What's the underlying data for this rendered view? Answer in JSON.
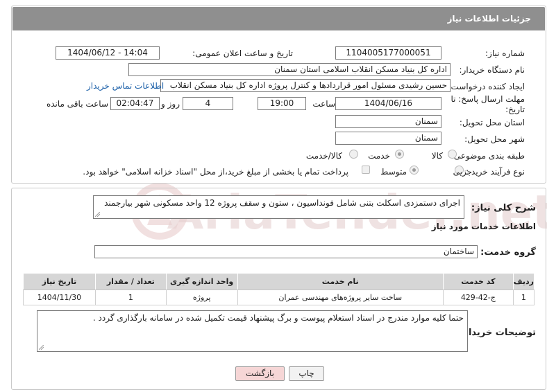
{
  "header": {
    "title": "جزئیات اطلاعات نیاز"
  },
  "fields": {
    "need_number_label": "شماره نیاز:",
    "need_number": "1104005177000051",
    "announce_label": "تاریخ و ساعت اعلان عمومی:",
    "announce_value": "1404/06/12 - 14:04",
    "buyer_org_label": "نام دستگاه خریدار:",
    "buyer_org": "اداره کل بنیاد مسکن انقلاب اسلامی استان سمنان",
    "creator_label": "ایجاد کننده درخواست:",
    "creator": "حسین رشیدی مسئول امور قراردادها و کنترل پروژه اداره کل بنیاد مسکن انقلاب",
    "buyer_contact_link": "اطلاعات تماس خریدار",
    "deadline_label_1": "مهلت ارسال پاسخ: تا",
    "deadline_label_2": "تاریخ:",
    "deadline_date": "1404/06/16",
    "time_label": "ساعت",
    "deadline_time": "19:00",
    "days_value": "4",
    "days_label": "روز و",
    "remaining_time": "02:04:47",
    "remaining_label": "ساعت باقی مانده",
    "province_label": "استان محل تحویل:",
    "province": "سمنان",
    "city_label": "شهر محل تحویل:",
    "city": "سمنان",
    "category_label": "طبقه بندی موضوعی:",
    "category_options": [
      "کالا",
      "خدمت",
      "کالا/خدمت"
    ],
    "process_label": "نوع فرآیند خرید :",
    "process_options": [
      "جزیی",
      "متوسط"
    ],
    "payment_note": "پرداخت تمام یا بخشی از مبلغ خرید،از محل \"اسناد خزانه اسلامی\" خواهد بود."
  },
  "summary": {
    "label": "شرح کلی نیاز:",
    "text": "اجرای دستمزدی اسکلت بتنی شامل فونداسیون ، ستون و سقف پروژه 12 واحد مسکونی شهر بیارجمند"
  },
  "services": {
    "title": "اطلاعات خدمات مورد نیاز",
    "group_label": "گروه خدمت:",
    "group_value": "ساختمان",
    "columns": [
      "ردیف",
      "کد خدمت",
      "نام خدمت",
      "واحد اندازه گیری",
      "تعداد / مقدار",
      "تاریخ نیاز"
    ],
    "rows": [
      {
        "row": "1",
        "code": "ج-42-429",
        "name": "ساخت سایر پروژه‌های مهندسی عمران",
        "unit": "پروژه",
        "qty": "1",
        "date": "1404/11/30"
      }
    ]
  },
  "buyer_notes": {
    "label": "توضیحات خریدار:",
    "text": "حتما کلیه موارد مندرج در اسناد استعلام پیوست و برگ پیشنهاد قیمت تکمیل شده در سامانه بارگذاری گردد ."
  },
  "buttons": {
    "print": "چاپ",
    "back": "بازگشت"
  },
  "watermark": "AriaTender.net",
  "colors": {
    "header_bg": "#8f8f8f",
    "link": "#1a5fa8",
    "back_btn_bg": "#f6d6d6",
    "watermark": "#e8c9c9"
  }
}
